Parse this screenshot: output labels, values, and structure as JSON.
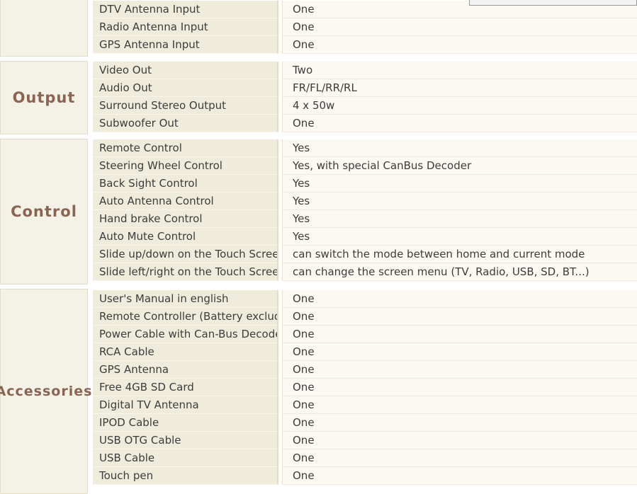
{
  "sections": [
    {
      "category": "",
      "rows": [
        {
          "label": "DTV Antenna Input",
          "value": "One"
        },
        {
          "label": "Radio Antenna Input",
          "value": "One"
        },
        {
          "label": "GPS Antenna Input",
          "value": "One"
        }
      ]
    },
    {
      "category": "Output",
      "rows": [
        {
          "label": "Video Out",
          "value": "Two"
        },
        {
          "label": "Audio Out",
          "value": "FR/FL/RR/RL"
        },
        {
          "label": "Surround Stereo Output",
          "value": "4 x 50w"
        },
        {
          "label": "Subwoofer Out",
          "value": "One"
        }
      ]
    },
    {
      "category": "Control",
      "rows": [
        {
          "label": "Remote Control",
          "value": "Yes"
        },
        {
          "label": "Steering Wheel Control",
          "value": "Yes, with special CanBus Decoder"
        },
        {
          "label": "Back Sight Control",
          "value": "Yes"
        },
        {
          "label": "Auto Antenna Control",
          "value": "Yes"
        },
        {
          "label": "Hand brake Control",
          "value": "Yes"
        },
        {
          "label": "Auto Mute Control",
          "value": "Yes"
        },
        {
          "label": "Slide up/down on the Touch Screen",
          "value": "can switch the mode between home and current mode"
        },
        {
          "label": "Slide left/right on the Touch Screen",
          "value": "can change the screen menu (TV, Radio, USB, SD, BT...)"
        }
      ]
    },
    {
      "category": "Accessories",
      "rows": [
        {
          "label": "User's Manual in english",
          "value": "One"
        },
        {
          "label": "Remote Controller (Battery excluded)",
          "value": "One"
        },
        {
          "label": "Power Cable with Can-Bus Decoder",
          "value": "One"
        },
        {
          "label": "RCA Cable",
          "value": "One"
        },
        {
          "label": "GPS Antenna",
          "value": "One"
        },
        {
          "label": "Free 4GB SD Card",
          "value": "One"
        },
        {
          "label": "Digital TV Antenna",
          "value": "One"
        },
        {
          "label": "IPOD Cable",
          "value": "One"
        },
        {
          "label": "USB OTG Cable",
          "value": "One"
        },
        {
          "label": "USB Cable",
          "value": "One"
        },
        {
          "label": "Touch pen",
          "value": "One"
        }
      ]
    }
  ]
}
